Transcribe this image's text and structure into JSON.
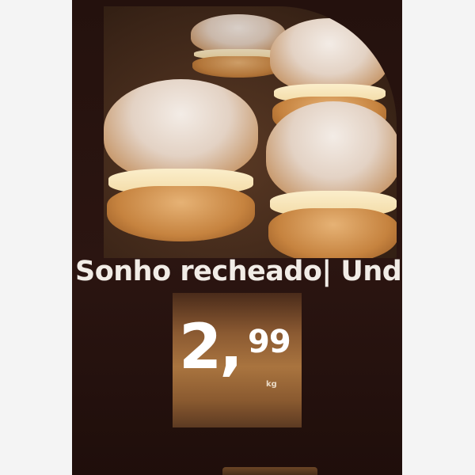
{
  "product": {
    "name": "Sonho recheado| Und",
    "price_integer": "2,",
    "price_decimal": "99",
    "price_unit": "kg"
  },
  "colors": {
    "panel_background": "#2a1410",
    "price_tag": "#a9743f",
    "text": "#f1ece6"
  },
  "image": {
    "subject": "sugar-dusted cream-filled doughnuts"
  }
}
